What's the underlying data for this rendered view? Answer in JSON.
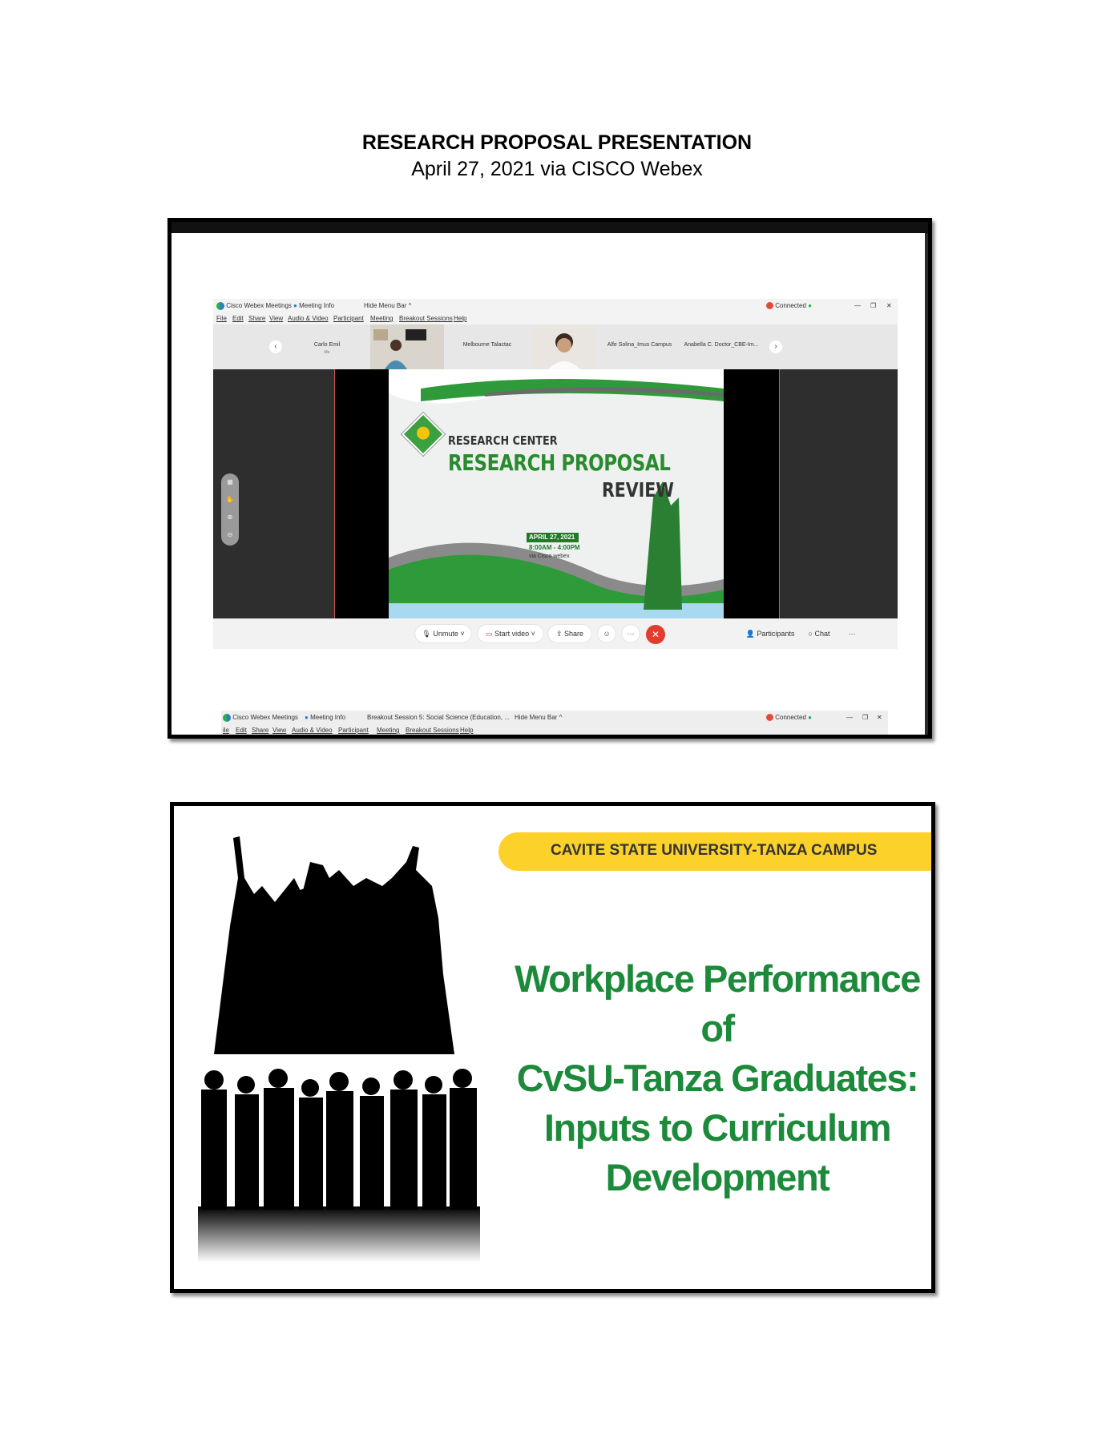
{
  "document": {
    "title": "RESEARCH PROPOSAL PRESENTATION",
    "subtitle": "April 27, 2021 via CISCO Webex"
  },
  "webex_window": {
    "app_name": "Cisco Webex Meetings",
    "meeting_info": "Meeting Info",
    "hide_menu_bar": "Hide Menu Bar ^",
    "connected": "Connected",
    "menu": [
      "File",
      "Edit",
      "Share",
      "View",
      "Audio & Video",
      "Participant",
      "Meeting",
      "Breakout Sessions",
      "Help"
    ],
    "participants": [
      {
        "name": "Carlo Emil",
        "sub": "Me"
      },
      {
        "name": "",
        "sub": ""
      },
      {
        "name": "Melbourne Talactac",
        "sub": ""
      },
      {
        "name": "",
        "sub": ""
      },
      {
        "name": "Alfe Solina_Imus Campus",
        "sub": ""
      },
      {
        "name": "Anabella C. Doctor_CBE-Im...",
        "sub": ""
      }
    ],
    "shared_slide": {
      "line1": "RESEARCH CENTER",
      "line2": "RESEARCH PROPOSAL",
      "line3": "REVIEW",
      "date": "APRIL 27, 2021",
      "time": "8:00AM - 4:00PM",
      "via": "via Cisco webex"
    },
    "controls": {
      "unmute": "Unmute",
      "start_video": "Start video",
      "share": "Share",
      "participants": "Participants",
      "chat": "Chat"
    }
  },
  "webex_window_2": {
    "app_name": "Cisco Webex Meetings",
    "meeting_info": "Meeting Info",
    "breakout": "Breakout Session 5: Social Science (Education, ...",
    "hide_menu_bar": "Hide Menu Bar ^",
    "connected": "Connected",
    "menu": [
      "ile",
      "Edit",
      "Share",
      "View",
      "Audio & Video",
      "Participant",
      "Meeting",
      "Breakout Sessions",
      "Help"
    ]
  },
  "title_slide": {
    "campus": "CAVITE STATE UNIVERSITY-TANZA CAMPUS",
    "title_lines": [
      "Workplace Performance of",
      "CvSU-Tanza Graduates:",
      "Inputs to Curriculum",
      "Development"
    ]
  },
  "colors": {
    "webex_green": "#2a8a2e",
    "banner_yellow": "#fcd12a",
    "title_green": "#1c8a3a",
    "end_call_red": "#e33b2e"
  }
}
